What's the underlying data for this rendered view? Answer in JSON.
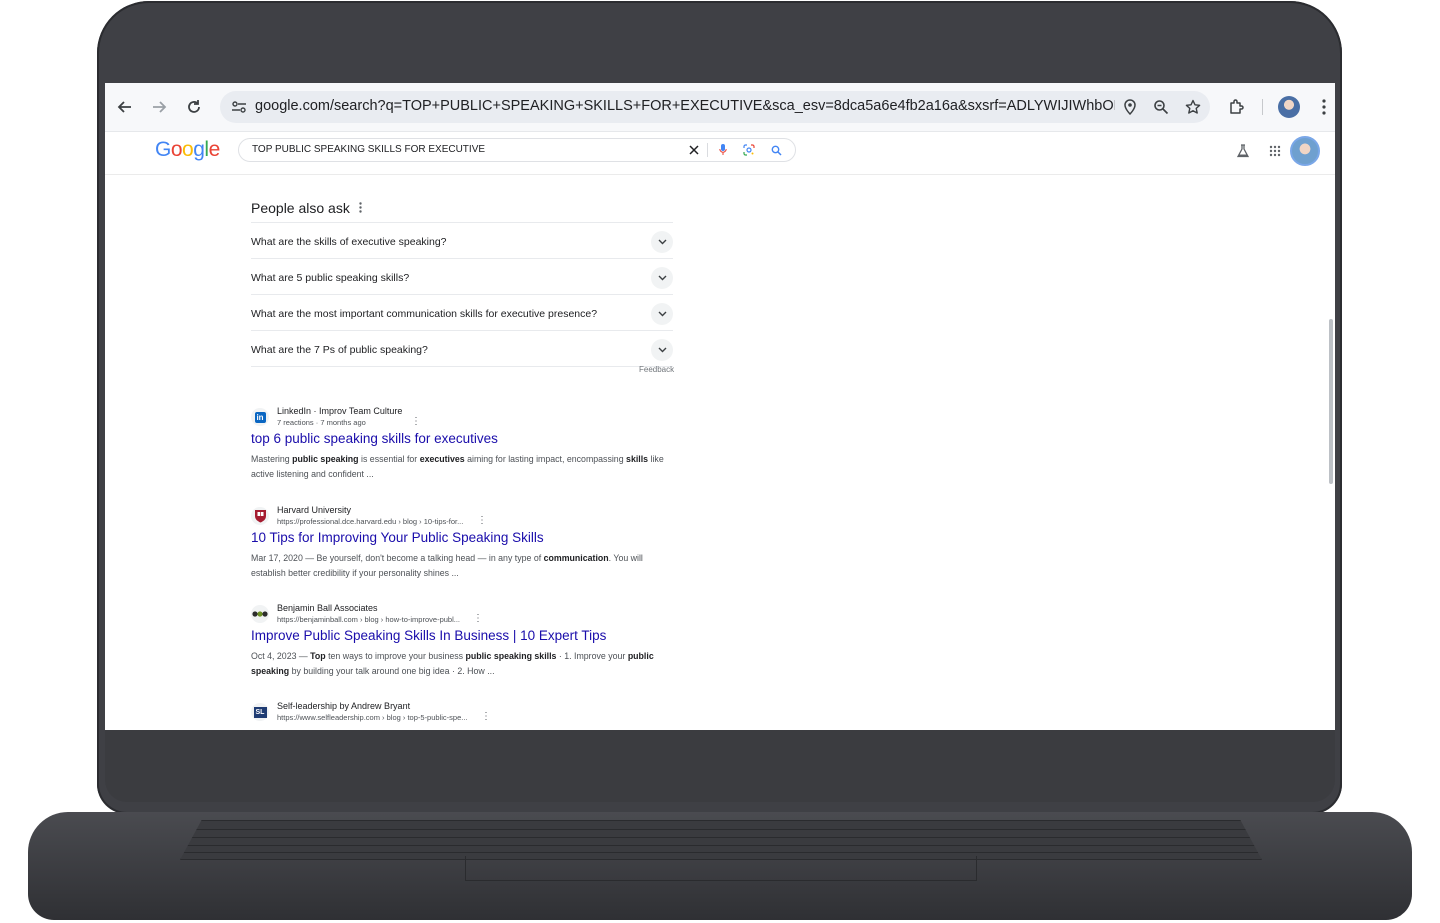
{
  "browser": {
    "url": "google.com/search?q=TOP+PUBLIC+SPEAKING+SKILLS+FOR+EXECUTIVE&sca_esv=8dca5a6e4fb2a16a&sxsrf=ADLYWIJIWhbOLmMlskujC9..."
  },
  "google": {
    "logo": "Google",
    "query": "TOP PUBLIC SPEAKING SKILLS FOR EXECUTIVE"
  },
  "paa": {
    "title": "People also ask",
    "questions": [
      "What are the skills of executive speaking?",
      "What are 5 public speaking skills?",
      "What are the most important communication skills for executive presence?",
      "What are the 7 Ps of public speaking?"
    ],
    "feedback": "Feedback"
  },
  "results": [
    {
      "site": "LinkedIn · Improv Team Culture",
      "meta": "7 reactions · 7 months ago",
      "title": "top 6 public speaking skills for executives",
      "snippet_html": "Mastering <b>public speaking</b> is essential for <b>executives</b> aiming for lasting impact, encompassing <b>skills</b> like active listening and confident ..."
    },
    {
      "site": "Harvard University",
      "meta": "https://professional.dce.harvard.edu › blog › 10-tips-for...",
      "title": "10 Tips for Improving Your Public Speaking Skills",
      "snippet_html": "Mar 17, 2020 — Be yourself, don't become a talking head — in any type of <b>communication</b>. You will establish better credibility if your personality shines ..."
    },
    {
      "site": "Benjamin Ball Associates",
      "meta": "https://benjaminball.com › blog › how-to-improve-publ...",
      "title": "Improve Public Speaking Skills In Business | 10 Expert Tips",
      "snippet_html": "Oct 4, 2023 — <b>Top</b> ten ways to improve your business <b>public speaking skills</b> · 1. Improve your <b>public speaking</b> by building your talk around one big idea · 2. How ..."
    },
    {
      "site": "Self-leadership by Andrew Bryant",
      "meta": "https://www.selfleadership.com › blog › top-5-public-spe...",
      "title": "",
      "snippet_html": ""
    }
  ],
  "colors": {
    "link": "#1a0dab",
    "frame": "#3f4045"
  }
}
